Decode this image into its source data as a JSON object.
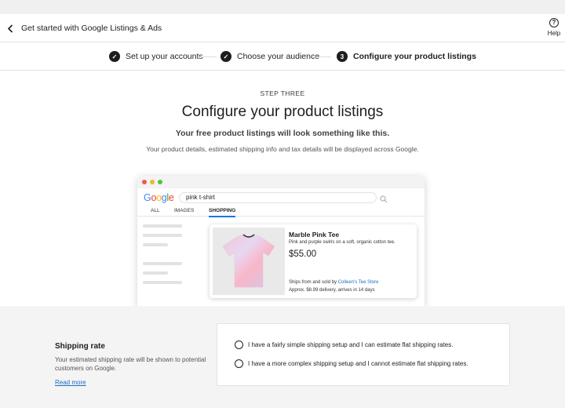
{
  "header": {
    "title": "Get started with Google Listings & Ads",
    "help_label": "Help"
  },
  "stepper": {
    "steps": [
      {
        "number": "1",
        "label": "Set up your accounts",
        "state": "complete"
      },
      {
        "number": "2",
        "label": "Choose your audience",
        "state": "complete"
      },
      {
        "number": "3",
        "label": "Configure your product listings",
        "state": "active"
      }
    ],
    "check_glyph": "✓"
  },
  "intro": {
    "eyebrow": "STEP THREE",
    "title": "Configure your product listings",
    "subtitle": "Your free product listings will look something like this.",
    "description": "Your product details, estimated shipping info and tax details will be displayed across Google."
  },
  "preview": {
    "logo": "Google",
    "search_query": "pink t-shirt",
    "tabs": [
      "ALL",
      "IMAGES",
      "SHOPPING"
    ],
    "selected_tab": "SHOPPING",
    "product": {
      "name": "Marble Pink Tee",
      "description": "Pink and purple swirls on a soft, organic cotton tee.",
      "price": "$55.00",
      "shipping_prefix": "Ships from and sold by ",
      "store": "Colleen's Tee Store",
      "delivery": "Approx. $8.99 delivery, arrives in 14 days"
    }
  },
  "shipping": {
    "title": "Shipping rate",
    "description": "Your estimated shipping rate will be shown to potential customers on Google.",
    "read_more": "Read more",
    "options": [
      "I have a fairly simple shipping setup and I can estimate flat shipping rates.",
      "I have a more complex shipping setup and I cannot estimate flat shipping rates."
    ]
  },
  "colors": {
    "link": "#1a6fc4",
    "tab_underline": "#1a73e8",
    "dark": "#1e1e1e"
  }
}
